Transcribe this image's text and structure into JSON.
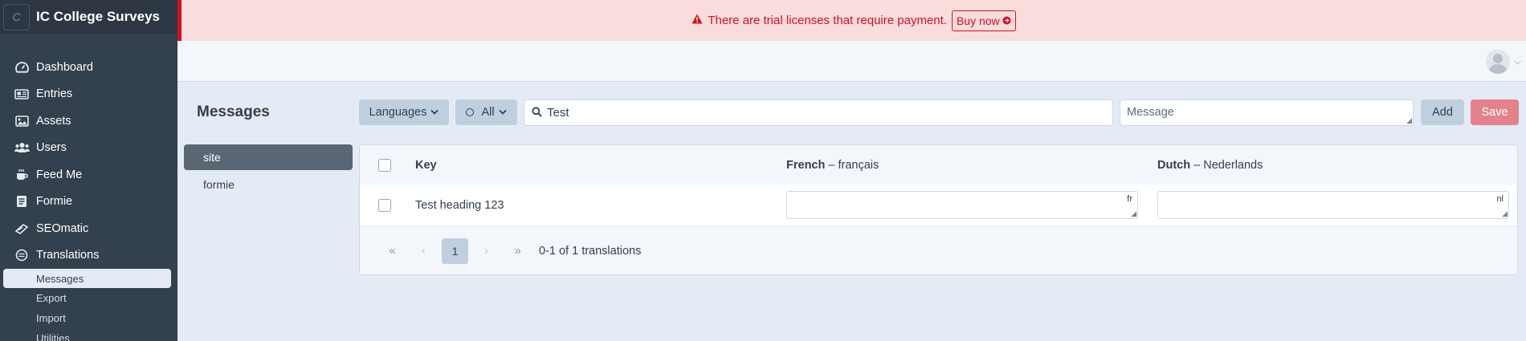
{
  "app": {
    "site_logo_letter": "C",
    "site_name": "IC College Surveys"
  },
  "nav": {
    "items": [
      {
        "label": "Dashboard",
        "icon": "gauge-icon"
      },
      {
        "label": "Entries",
        "icon": "newspaper-icon"
      },
      {
        "label": "Assets",
        "icon": "image-icon"
      },
      {
        "label": "Users",
        "icon": "users-icon"
      },
      {
        "label": "Feed Me",
        "icon": "feed-icon"
      },
      {
        "label": "Formie",
        "icon": "form-icon"
      },
      {
        "label": "SEOmatic",
        "icon": "seo-icon"
      },
      {
        "label": "Translations",
        "icon": "globe-icon"
      }
    ],
    "subitems": [
      {
        "label": "Messages",
        "active": true
      },
      {
        "label": "Export"
      },
      {
        "label": "Import"
      },
      {
        "label": "Utilities"
      }
    ]
  },
  "alert": {
    "message": "There are trial licenses that require payment.",
    "buy_label": "Buy now"
  },
  "main": {
    "title": "Messages",
    "languages_label": "Languages",
    "status_label": "All",
    "search_value": "Test",
    "message_placeholder": "Message",
    "add_label": "Add",
    "save_label": "Save"
  },
  "sources": [
    {
      "label": "site",
      "active": true
    },
    {
      "label": "formie"
    }
  ],
  "table": {
    "key_header": "Key",
    "columns": [
      {
        "lang": "French",
        "native": "– français",
        "code": "fr"
      },
      {
        "lang": "Dutch",
        "native": "– Nederlands",
        "code": "nl"
      }
    ],
    "rows": [
      {
        "key": "Test heading 123",
        "fr": "",
        "nl": ""
      }
    ]
  },
  "pagination": {
    "current": "1",
    "summary": "0-1 of 1 translations"
  },
  "colors": {
    "sidebar": "#33404d",
    "alert_bg": "#f9dcdc",
    "alert_text": "#cf1124",
    "save_button": "#e3828c"
  }
}
